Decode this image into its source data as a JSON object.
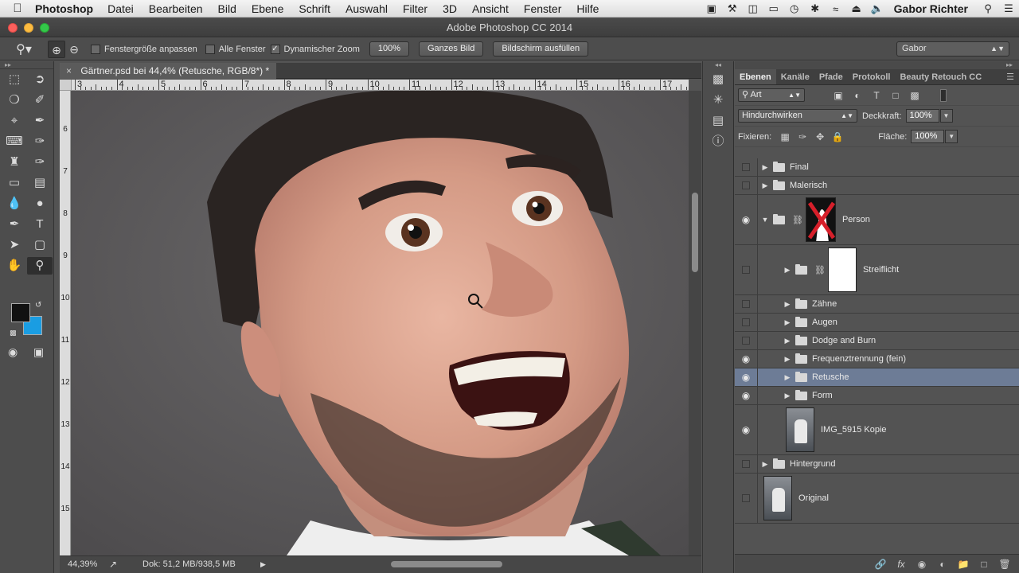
{
  "menubar": {
    "app_name": "Photoshop",
    "items": [
      "Datei",
      "Bearbeiten",
      "Bild",
      "Ebene",
      "Schrift",
      "Auswahl",
      "Filter",
      "3D",
      "Ansicht",
      "Fenster",
      "Hilfe"
    ],
    "user": "Gabor Richter"
  },
  "window": {
    "title": "Adobe Photoshop CC 2014"
  },
  "options": {
    "fit_window": "Fenstergröße anpassen",
    "all_windows": "Alle Fenster",
    "dynamic_zoom": "Dynamischer Zoom",
    "zoom_100": "100%",
    "whole_image": "Ganzes Bild",
    "fill_screen": "Bildschirm ausfüllen",
    "workspace": "Gabor"
  },
  "document": {
    "tab_title": "Gärtner.psd bei 44,4% (Retusche, RGB/8*) *",
    "ruler_h": [
      "3",
      "4",
      "5",
      "6",
      "7",
      "8",
      "9",
      "10",
      "11",
      "12",
      "13",
      "14",
      "15",
      "16",
      "17"
    ],
    "ruler_v": [
      "6",
      "7",
      "8",
      "9",
      "10",
      "11",
      "12",
      "13",
      "14",
      "15"
    ],
    "zoom": "44,39%",
    "doc_size": "Dok: 51,2 MB/938,5 MB"
  },
  "layers_panel": {
    "tabs": [
      "Ebenen",
      "Kanäle",
      "Pfade",
      "Protokoll",
      "Beauty Retouch CC"
    ],
    "filter_kind": "Art",
    "blend_mode": "Hindurchwirken",
    "opacity_label": "Deckkraft:",
    "opacity": "100%",
    "lock_label": "Fixieren:",
    "fill_label": "Fläche:",
    "fill": "100%",
    "layers": [
      {
        "name": "Final",
        "visible": false,
        "type": "group",
        "indent": 0
      },
      {
        "name": "Malerisch",
        "visible": false,
        "type": "group",
        "indent": 0
      },
      {
        "name": "Person",
        "visible": true,
        "type": "group-open-mask",
        "indent": 0
      },
      {
        "name": "Streiflicht",
        "visible": false,
        "type": "group-mask",
        "indent": 1
      },
      {
        "name": "Zähne",
        "visible": false,
        "type": "group",
        "indent": 1
      },
      {
        "name": "Augen",
        "visible": false,
        "type": "group",
        "indent": 1
      },
      {
        "name": "Dodge and Burn",
        "visible": false,
        "type": "group",
        "indent": 1
      },
      {
        "name": "Frequenztrennung (fein)",
        "visible": true,
        "type": "group",
        "indent": 1
      },
      {
        "name": "Retusche",
        "visible": true,
        "type": "group",
        "indent": 1,
        "selected": true
      },
      {
        "name": "Form",
        "visible": true,
        "type": "group",
        "indent": 1
      },
      {
        "name": "IMG_5915 Kopie",
        "visible": true,
        "type": "image",
        "indent": 1
      },
      {
        "name": "Hintergrund",
        "visible": false,
        "type": "group",
        "indent": 0
      },
      {
        "name": "Original",
        "visible": false,
        "type": "image",
        "indent": 0
      }
    ]
  },
  "colors": {
    "foreground": "#111111",
    "background": "#1a9de2",
    "selection": "#6d7c96"
  }
}
